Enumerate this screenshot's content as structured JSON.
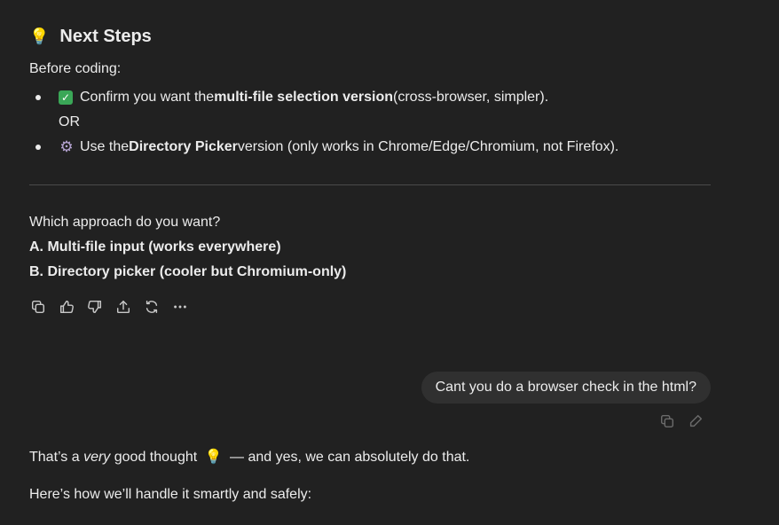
{
  "section": {
    "emoji": "💡",
    "title": "Next Steps",
    "intro": "Before coding:",
    "bullets": [
      {
        "icon": "check-box-icon",
        "pre": "Confirm you want the ",
        "bold": "multi-file selection version",
        "post": " (cross-browser, simpler)."
      },
      {
        "icon": "gear-icon",
        "pre": "Use the ",
        "bold": "Directory Picker",
        "post": " version (only works in Chrome/Edge/Chromium, not Firefox)."
      }
    ],
    "or_text": "OR"
  },
  "question": {
    "prompt": "Which approach do you want?",
    "option_a": "A. Multi-file input (works everywhere)",
    "option_b": "B. Directory picker (cooler but Chromium-only)"
  },
  "user_message": "Cant you do a browser check in the html?",
  "reply": {
    "line1_pre": "That’s a ",
    "line1_italic": "very",
    "line1_mid": " good thought ",
    "line1_emoji": "💡",
    "line1_post": " — and yes, we can absolutely do that.",
    "line2": "Here’s how we’ll handle it smartly and safely:"
  },
  "colors": {
    "background": "#212121",
    "text": "#ececec",
    "bubble": "#303030",
    "check": "#3aa757"
  }
}
